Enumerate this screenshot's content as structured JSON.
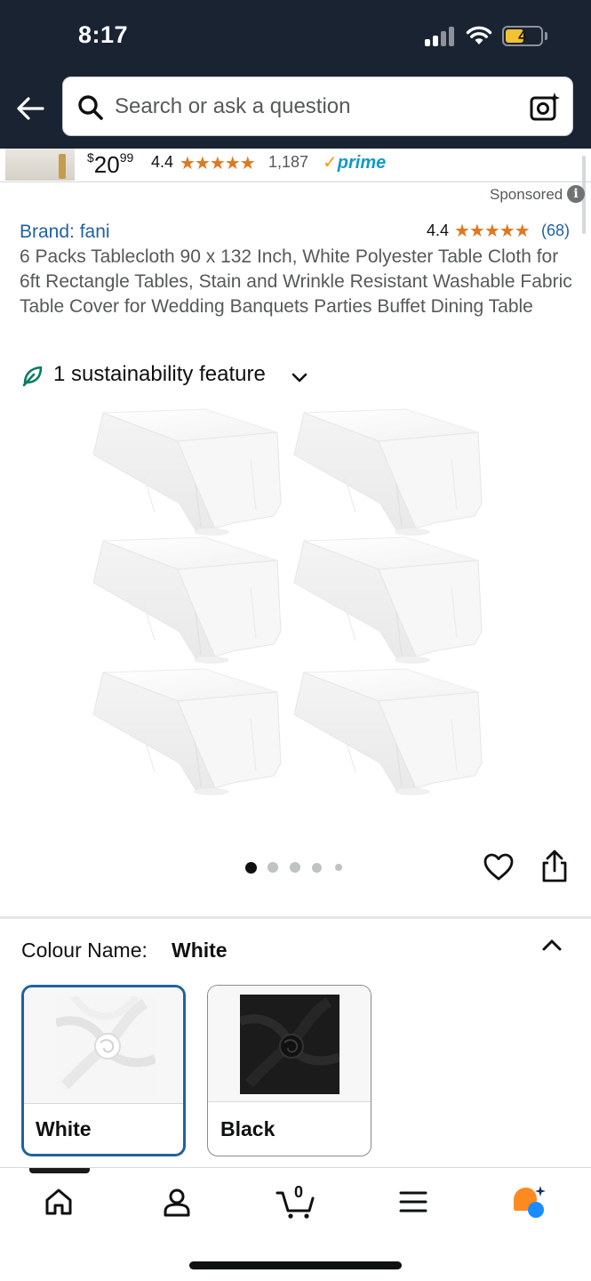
{
  "status_bar": {
    "time": "8:17",
    "battery": "4"
  },
  "header": {
    "search_placeholder": "Search or ask a question"
  },
  "sponsored_strip": {
    "price_whole": "20",
    "price_fraction": "99",
    "currency": "$",
    "rating": "4.4",
    "rating_count": "1,187",
    "prime": "prime"
  },
  "product": {
    "sponsored_label": "Sponsored",
    "brand": "Brand: fani",
    "rating": "4.4",
    "rating_count": "(68)",
    "title": "6 Packs Tablecloth 90 x 132 Inch, White Polyester Table Cloth for 6ft Rectangle Tables, Stain and Wrinkle Resistant Washable Fabric Table Cover for Wedding Banquets Parties Buffet Dining Table",
    "sustainability": "1 sustainability feature",
    "gallery_dots": 5,
    "gallery_active_index": 0
  },
  "colour": {
    "label": "Colour Name:",
    "selected_value": "White",
    "options": [
      {
        "label": "White",
        "selected": true
      },
      {
        "label": "Black",
        "selected": false
      }
    ]
  },
  "bottom_nav": {
    "cart_count": "0",
    "items": [
      "home",
      "account",
      "cart",
      "menu",
      "rufus"
    ]
  },
  "colors": {
    "header_bg": "#1a2332",
    "link": "#2162a1",
    "star": "#de7921",
    "prime": "#1399c6",
    "selected_border": "#2162a1"
  }
}
